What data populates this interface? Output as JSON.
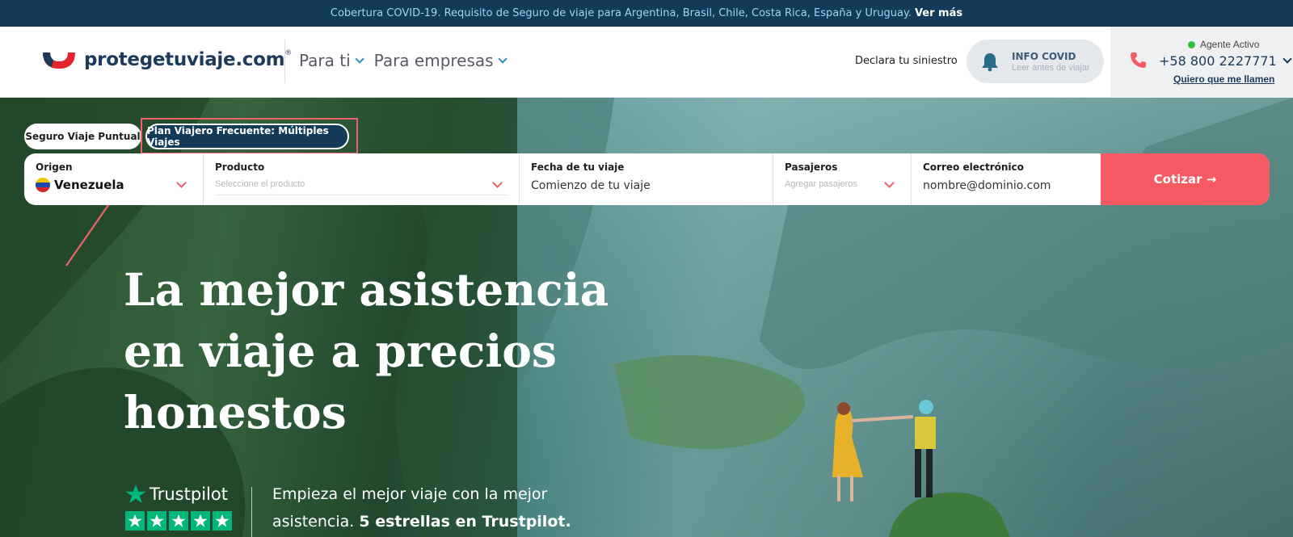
{
  "topbar": {
    "message": "Cobertura COVID-19. Requisito de Seguro de viaje para Argentina, Brasil, Chile, Costa Rica, España y Uruguay.",
    "link": "Ver más"
  },
  "header": {
    "logo_text": "protegetuviaje.com",
    "logo_reg": "®",
    "nav": [
      "Para ti",
      "Para empresas"
    ],
    "declare": "Declara tu siniestro",
    "covid": {
      "title": "INFO COVID",
      "subtitle": "Leer antes de viajar"
    },
    "contact": {
      "agent_status": "Agente Activo",
      "phone": "+58 800 2227771",
      "callback": "Quiero que me llamen"
    }
  },
  "tabs": {
    "puntual": "Seguro Viaje Puntual",
    "frecuente": "Plan Viajero Frecuente: Múltiples Viajes"
  },
  "form": {
    "origen": {
      "label": "Origen",
      "value": "Venezuela"
    },
    "producto": {
      "label": "Producto",
      "placeholder": "Seleccione el producto"
    },
    "fecha": {
      "label": "Fecha de tu viaje",
      "value": "Comienzo de tu viaje"
    },
    "pasajeros": {
      "label": "Pasajeros",
      "placeholder": "Agregar pasajeros"
    },
    "correo": {
      "label": "Correo electrónico",
      "value": "nombre@dominio.com"
    },
    "submit": "Cotizar →"
  },
  "hero": {
    "headline_line1": "La mejor asistencia",
    "headline_line2": "en viaje a precios",
    "headline_line3": "honestos"
  },
  "trustpilot": {
    "brand": "Trustpilot",
    "rating_stars": 5,
    "text_line1": "Empieza el mejor viaje con la mejor",
    "text_line2_plain": "asistencia.",
    "text_line2_bold": "5 estrellas en Trustpilot."
  },
  "colors": {
    "accent_red": "#f65a63",
    "navy": "#143a5a",
    "trustpilot_green": "#00b67a"
  }
}
